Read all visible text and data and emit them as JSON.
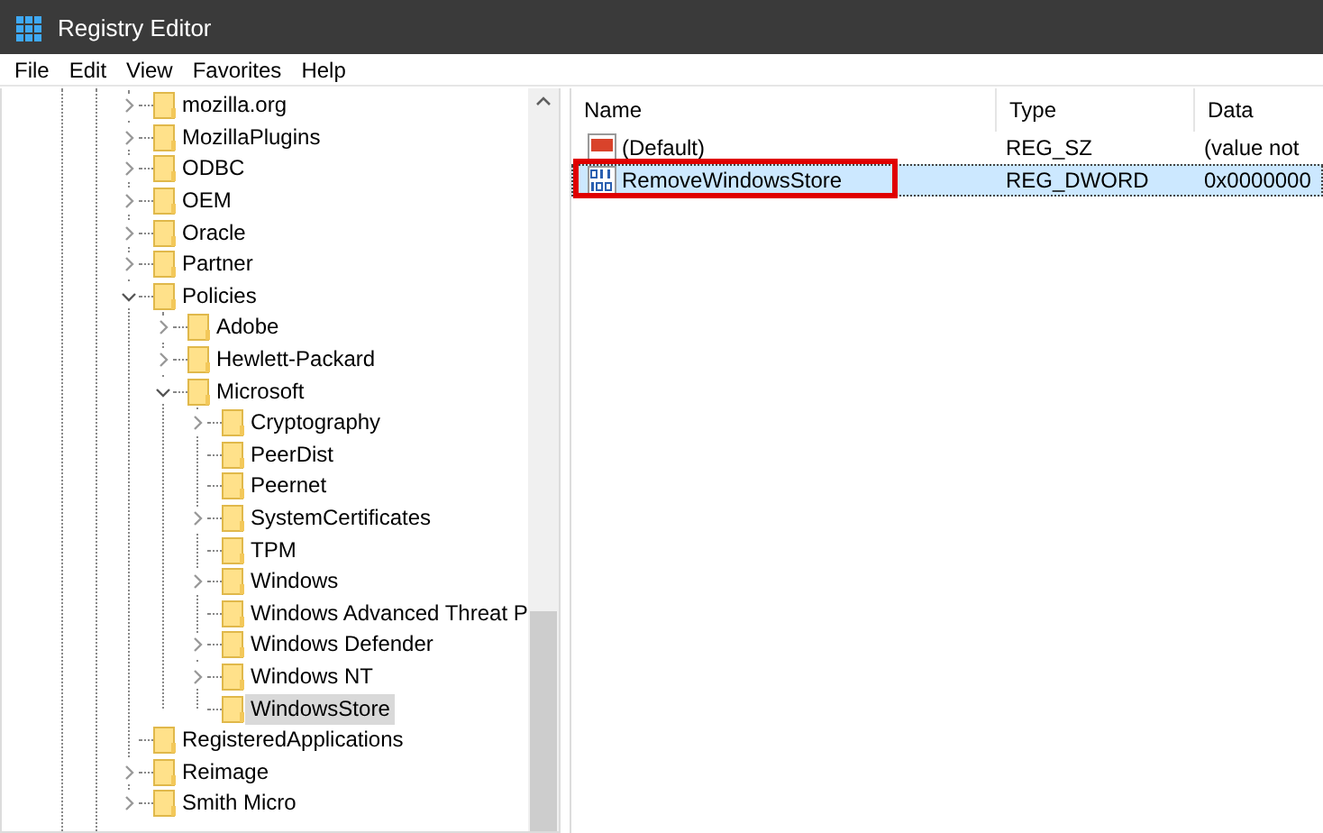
{
  "window": {
    "title": "Registry Editor"
  },
  "menu": [
    "File",
    "Edit",
    "View",
    "Favorites",
    "Help"
  ],
  "tree": [
    {
      "label": "mozilla.org",
      "has_subkeys": true,
      "expanded": false,
      "selected": false
    },
    {
      "label": "MozillaPlugins",
      "has_subkeys": true,
      "expanded": false,
      "selected": false
    },
    {
      "label": "ODBC",
      "has_subkeys": true,
      "expanded": false,
      "selected": false
    },
    {
      "label": "OEM",
      "has_subkeys": true,
      "expanded": false,
      "selected": false
    },
    {
      "label": "Oracle",
      "has_subkeys": true,
      "expanded": false,
      "selected": false
    },
    {
      "label": "Partner",
      "has_subkeys": true,
      "expanded": false,
      "selected": false
    },
    {
      "label": "Policies",
      "has_subkeys": true,
      "expanded": true,
      "selected": false,
      "children": [
        {
          "label": "Adobe",
          "has_subkeys": true,
          "expanded": false,
          "selected": false
        },
        {
          "label": "Hewlett-Packard",
          "has_subkeys": true,
          "expanded": false,
          "selected": false
        },
        {
          "label": "Microsoft",
          "has_subkeys": true,
          "expanded": true,
          "selected": false,
          "children": [
            {
              "label": "Cryptography",
              "has_subkeys": true,
              "expanded": false,
              "selected": false
            },
            {
              "label": "PeerDist",
              "has_subkeys": false,
              "expanded": false,
              "selected": false
            },
            {
              "label": "Peernet",
              "has_subkeys": false,
              "expanded": false,
              "selected": false
            },
            {
              "label": "SystemCertificates",
              "has_subkeys": true,
              "expanded": false,
              "selected": false
            },
            {
              "label": "TPM",
              "has_subkeys": false,
              "expanded": false,
              "selected": false
            },
            {
              "label": "Windows",
              "has_subkeys": true,
              "expanded": false,
              "selected": false
            },
            {
              "label": "Windows Advanced Threat P",
              "has_subkeys": false,
              "expanded": false,
              "selected": false
            },
            {
              "label": "Windows Defender",
              "has_subkeys": true,
              "expanded": false,
              "selected": false
            },
            {
              "label": "Windows NT",
              "has_subkeys": true,
              "expanded": false,
              "selected": false
            },
            {
              "label": "WindowsStore",
              "has_subkeys": false,
              "expanded": false,
              "selected": true
            }
          ]
        }
      ]
    },
    {
      "label": "RegisteredApplications",
      "has_subkeys": false,
      "expanded": false,
      "selected": false
    },
    {
      "label": "Reimage",
      "has_subkeys": true,
      "expanded": false,
      "selected": false
    },
    {
      "label": "Smith Micro",
      "has_subkeys": true,
      "expanded": false,
      "selected": false
    }
  ],
  "values": {
    "columns": [
      "Name",
      "Type",
      "Data"
    ],
    "rows": [
      {
        "name": "(Default)",
        "type": "REG_SZ",
        "data": "(value not",
        "kind": "string",
        "selected": false,
        "annotated": false
      },
      {
        "name": "RemoveWindowsStore",
        "type": "REG_DWORD",
        "data": "0x0000000",
        "kind": "dword",
        "selected": true,
        "annotated": true
      }
    ]
  }
}
